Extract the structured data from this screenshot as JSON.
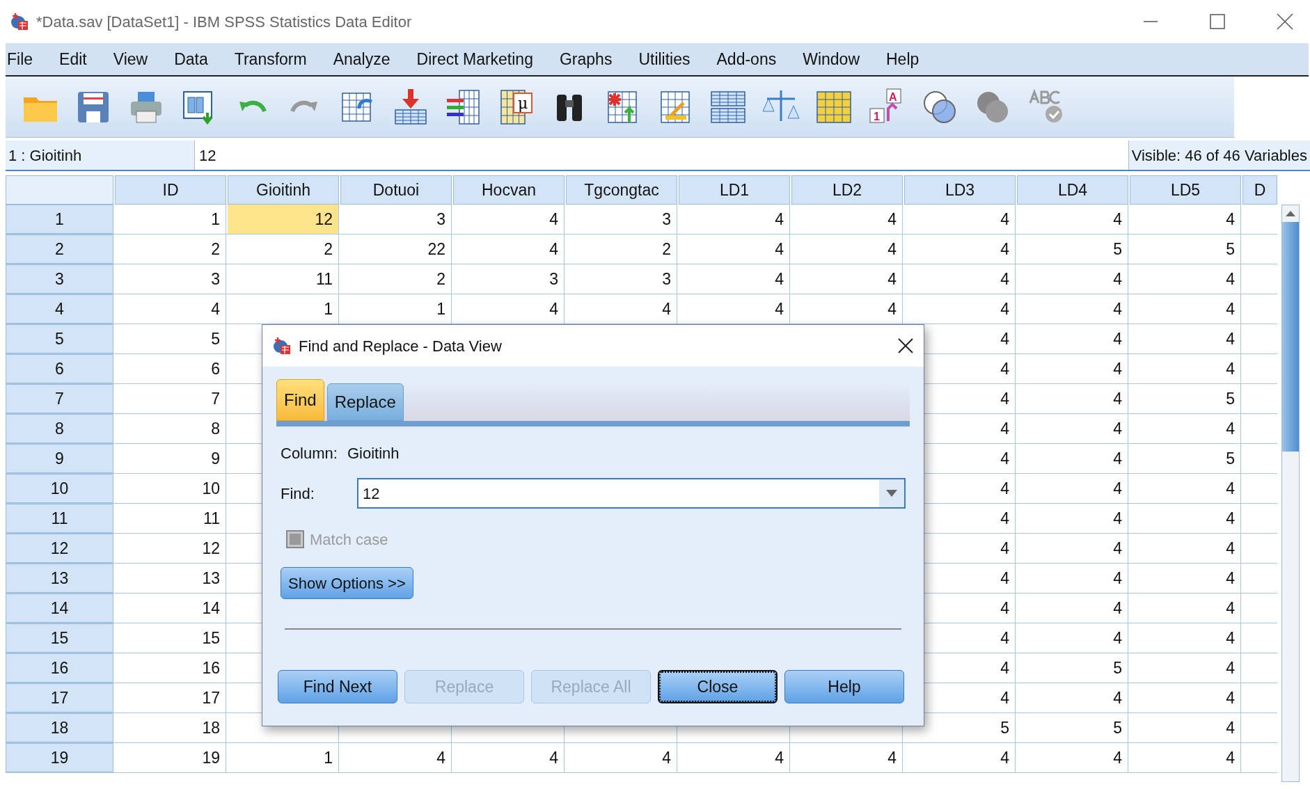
{
  "window": {
    "title": "*Data.sav [DataSet1] - IBM SPSS Statistics Data Editor"
  },
  "menu": [
    {
      "label": "File"
    },
    {
      "label": "Edit"
    },
    {
      "label": "View"
    },
    {
      "label": "Data"
    },
    {
      "label": "Transform"
    },
    {
      "label": "Analyze"
    },
    {
      "label": "Direct Marketing"
    },
    {
      "label": "Graphs"
    },
    {
      "label": "Utilities"
    },
    {
      "label": "Add-ons"
    },
    {
      "label": "Window"
    },
    {
      "label": "Help"
    }
  ],
  "toolbar": {
    "mu_glyph": "μ",
    "label_letter": "A",
    "label_number": "1"
  },
  "cell_editor": {
    "cell_ref": "1 : Gioitinh",
    "value": "12",
    "visible_count": "Visible: 46 of 46 Variables"
  },
  "grid": {
    "columns": [
      "ID",
      "Gioitinh",
      "Dotuoi",
      "Hocvan",
      "Tgcongtac",
      "LD1",
      "LD2",
      "LD3",
      "LD4",
      "LD5",
      "D"
    ],
    "rows": [
      {
        "number": "1",
        "cells": [
          {
            "text": "1",
            "selected": false
          },
          {
            "text": "12",
            "selected": true
          },
          {
            "text": "3",
            "selected": false
          },
          {
            "text": "4",
            "selected": false
          },
          {
            "text": "3",
            "selected": false
          },
          {
            "text": "4",
            "selected": false
          },
          {
            "text": "4",
            "selected": false
          },
          {
            "text": "4",
            "selected": false
          },
          {
            "text": "4",
            "selected": false
          },
          {
            "text": "4",
            "selected": false
          }
        ]
      },
      {
        "number": "2",
        "cells": [
          {
            "text": "2",
            "selected": false
          },
          {
            "text": "2",
            "selected": false
          },
          {
            "text": "22",
            "selected": false
          },
          {
            "text": "4",
            "selected": false
          },
          {
            "text": "2",
            "selected": false
          },
          {
            "text": "4",
            "selected": false
          },
          {
            "text": "4",
            "selected": false
          },
          {
            "text": "4",
            "selected": false
          },
          {
            "text": "5",
            "selected": false
          },
          {
            "text": "5",
            "selected": false
          }
        ]
      },
      {
        "number": "3",
        "cells": [
          {
            "text": "3",
            "selected": false
          },
          {
            "text": "11",
            "selected": false
          },
          {
            "text": "2",
            "selected": false
          },
          {
            "text": "3",
            "selected": false
          },
          {
            "text": "3",
            "selected": false
          },
          {
            "text": "4",
            "selected": false
          },
          {
            "text": "4",
            "selected": false
          },
          {
            "text": "4",
            "selected": false
          },
          {
            "text": "4",
            "selected": false
          },
          {
            "text": "4",
            "selected": false
          }
        ]
      },
      {
        "number": "4",
        "cells": [
          {
            "text": "4",
            "selected": false
          },
          {
            "text": "1",
            "selected": false
          },
          {
            "text": "1",
            "selected": false
          },
          {
            "text": "4",
            "selected": false
          },
          {
            "text": "4",
            "selected": false
          },
          {
            "text": "4",
            "selected": false
          },
          {
            "text": "4",
            "selected": false
          },
          {
            "text": "4",
            "selected": false
          },
          {
            "text": "4",
            "selected": false
          },
          {
            "text": "4",
            "selected": false
          }
        ]
      },
      {
        "number": "5",
        "cells": [
          {
            "text": "5",
            "selected": false
          },
          null,
          null,
          null,
          null,
          null,
          null,
          {
            "text": "4",
            "selected": false
          },
          {
            "text": "4",
            "selected": false
          },
          {
            "text": "4",
            "selected": false
          }
        ]
      },
      {
        "number": "6",
        "cells": [
          {
            "text": "6",
            "selected": false
          },
          null,
          null,
          null,
          null,
          null,
          null,
          {
            "text": "4",
            "selected": false
          },
          {
            "text": "4",
            "selected": false
          },
          {
            "text": "4",
            "selected": false
          }
        ]
      },
      {
        "number": "7",
        "cells": [
          {
            "text": "7",
            "selected": false
          },
          null,
          null,
          null,
          null,
          null,
          null,
          {
            "text": "4",
            "selected": false
          },
          {
            "text": "4",
            "selected": false
          },
          {
            "text": "5",
            "selected": false
          }
        ]
      },
      {
        "number": "8",
        "cells": [
          {
            "text": "8",
            "selected": false
          },
          null,
          null,
          null,
          null,
          null,
          null,
          {
            "text": "4",
            "selected": false
          },
          {
            "text": "4",
            "selected": false
          },
          {
            "text": "4",
            "selected": false
          }
        ]
      },
      {
        "number": "9",
        "cells": [
          {
            "text": "9",
            "selected": false
          },
          null,
          null,
          null,
          null,
          null,
          null,
          {
            "text": "4",
            "selected": false
          },
          {
            "text": "4",
            "selected": false
          },
          {
            "text": "5",
            "selected": false
          }
        ]
      },
      {
        "number": "10",
        "cells": [
          {
            "text": "10",
            "selected": false
          },
          null,
          null,
          null,
          null,
          null,
          null,
          {
            "text": "4",
            "selected": false
          },
          {
            "text": "4",
            "selected": false
          },
          {
            "text": "4",
            "selected": false
          }
        ]
      },
      {
        "number": "11",
        "cells": [
          {
            "text": "11",
            "selected": false
          },
          null,
          null,
          null,
          null,
          null,
          null,
          {
            "text": "4",
            "selected": false
          },
          {
            "text": "4",
            "selected": false
          },
          {
            "text": "4",
            "selected": false
          }
        ]
      },
      {
        "number": "12",
        "cells": [
          {
            "text": "12",
            "selected": false
          },
          null,
          null,
          null,
          null,
          null,
          null,
          {
            "text": "4",
            "selected": false
          },
          {
            "text": "4",
            "selected": false
          },
          {
            "text": "4",
            "selected": false
          }
        ]
      },
      {
        "number": "13",
        "cells": [
          {
            "text": "13",
            "selected": false
          },
          null,
          null,
          null,
          null,
          null,
          null,
          {
            "text": "4",
            "selected": false
          },
          {
            "text": "4",
            "selected": false
          },
          {
            "text": "4",
            "selected": false
          }
        ]
      },
      {
        "number": "14",
        "cells": [
          {
            "text": "14",
            "selected": false
          },
          null,
          null,
          null,
          null,
          null,
          null,
          {
            "text": "4",
            "selected": false
          },
          {
            "text": "4",
            "selected": false
          },
          {
            "text": "4",
            "selected": false
          }
        ]
      },
      {
        "number": "15",
        "cells": [
          {
            "text": "15",
            "selected": false
          },
          null,
          null,
          null,
          null,
          null,
          null,
          {
            "text": "4",
            "selected": false
          },
          {
            "text": "4",
            "selected": false
          },
          {
            "text": "4",
            "selected": false
          }
        ]
      },
      {
        "number": "16",
        "cells": [
          {
            "text": "16",
            "selected": false
          },
          null,
          null,
          null,
          null,
          null,
          null,
          {
            "text": "4",
            "selected": false
          },
          {
            "text": "5",
            "selected": false
          },
          {
            "text": "4",
            "selected": false
          }
        ]
      },
      {
        "number": "17",
        "cells": [
          {
            "text": "17",
            "selected": false
          },
          null,
          null,
          null,
          null,
          null,
          null,
          {
            "text": "4",
            "selected": false
          },
          {
            "text": "4",
            "selected": false
          },
          {
            "text": "4",
            "selected": false
          }
        ]
      },
      {
        "number": "18",
        "cells": [
          {
            "text": "18",
            "selected": false
          },
          null,
          null,
          null,
          null,
          null,
          null,
          {
            "text": "5",
            "selected": false
          },
          {
            "text": "5",
            "selected": false
          },
          {
            "text": "4",
            "selected": false
          }
        ]
      },
      {
        "number": "19",
        "cells": [
          {
            "text": "19",
            "selected": false
          },
          {
            "text": "1",
            "selected": false
          },
          {
            "text": "4",
            "selected": false
          },
          {
            "text": "4",
            "selected": false
          },
          {
            "text": "4",
            "selected": false
          },
          {
            "text": "4",
            "selected": false
          },
          {
            "text": "4",
            "selected": false
          },
          {
            "text": "4",
            "selected": false
          },
          {
            "text": "4",
            "selected": false
          },
          {
            "text": "4",
            "selected": false
          }
        ]
      }
    ]
  },
  "dialog": {
    "title": "Find and Replace - Data View",
    "tabs": [
      {
        "label": "Find",
        "selected": true
      },
      {
        "label": "Replace",
        "selected": false
      }
    ],
    "column_label": "Column:",
    "column_value": "Gioitinh",
    "find_label": "Find:",
    "find_value": "12",
    "match_case": {
      "label": "Match case",
      "checked": false,
      "disabled": true
    },
    "show_options": "Show Options >>",
    "buttons": [
      {
        "label": "Find Next",
        "disabled": false,
        "focused": false
      },
      {
        "label": "Replace",
        "disabled": true,
        "focused": false
      },
      {
        "label": "Replace All",
        "disabled": true,
        "focused": false
      },
      {
        "label": "Close",
        "disabled": false,
        "focused": true
      },
      {
        "label": "Help",
        "disabled": false,
        "focused": false
      }
    ]
  }
}
